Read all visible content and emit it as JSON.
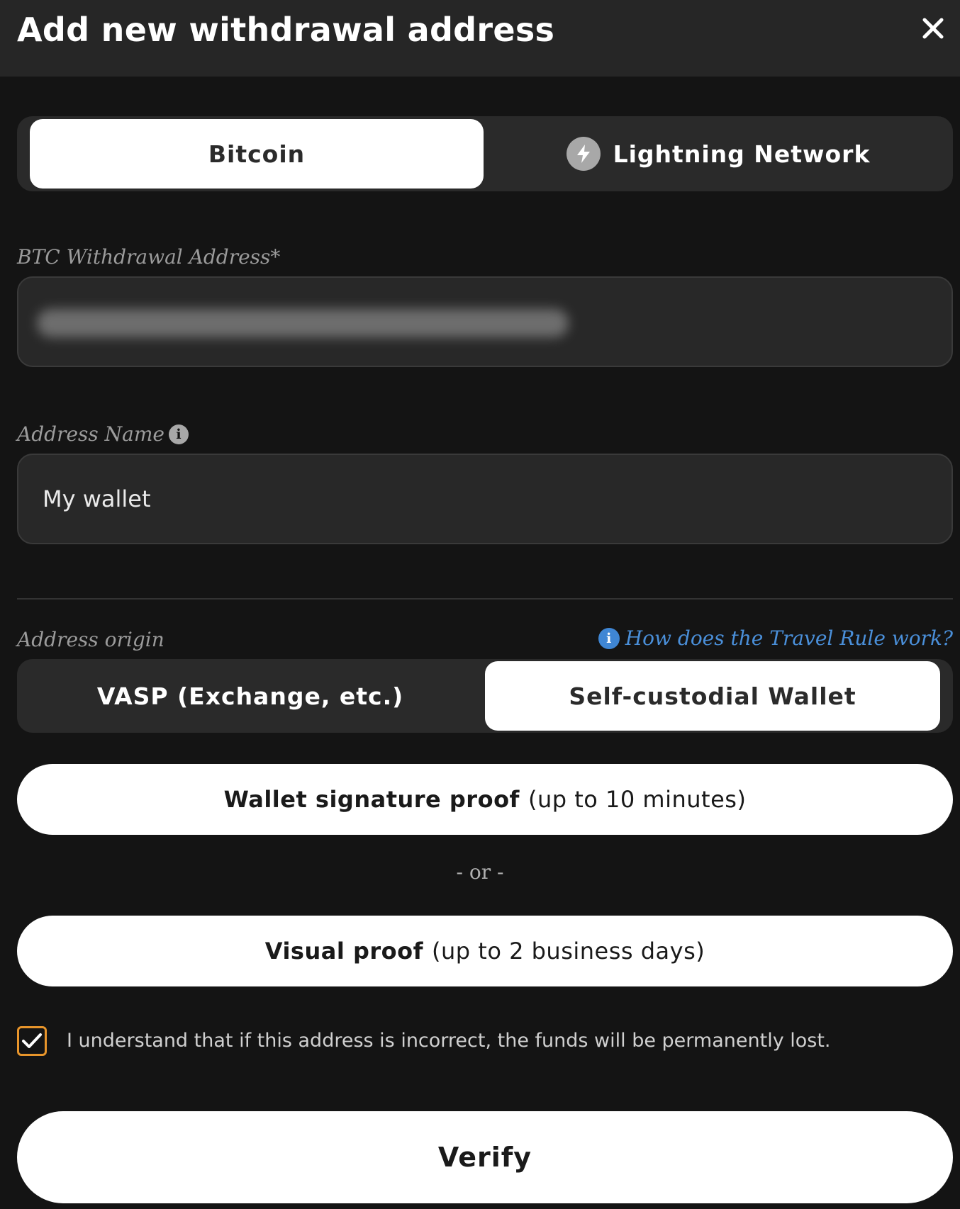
{
  "header": {
    "title": "Add new withdrawal address",
    "close_icon": "close-icon"
  },
  "network_tabs": {
    "bitcoin_label": "Bitcoin",
    "lightning_label": "Lightning Network",
    "lightning_icon": "bolt-icon",
    "selected": "Bitcoin"
  },
  "btc_address": {
    "label": "BTC Withdrawal Address*"
  },
  "address_name": {
    "label": "Address Name",
    "info_icon": "info-icon",
    "value": "My wallet"
  },
  "address_origin": {
    "label": "Address origin",
    "help_link": "How does the Travel Rule work?",
    "help_icon": "info-icon",
    "vasp_label": "VASP (Exchange, etc.)",
    "self_custodial_label": "Self-custodial Wallet",
    "selected": "Self-custodial Wallet"
  },
  "proofs": {
    "signature_bold": "Wallet signature proof",
    "signature_rest": "(up to 10 minutes)",
    "or_text": "- or -",
    "visual_bold": "Visual proof",
    "visual_rest": "(up to 2 business days)"
  },
  "acknowledgement": {
    "checked": true,
    "text": "I understand that if this address is incorrect, the funds will be permanently lost."
  },
  "verify_button": {
    "label": "Verify"
  },
  "colors": {
    "background": "#141414",
    "header": "#262626",
    "accent_checkbox": "#e8952b",
    "link": "#4a8fd9"
  }
}
